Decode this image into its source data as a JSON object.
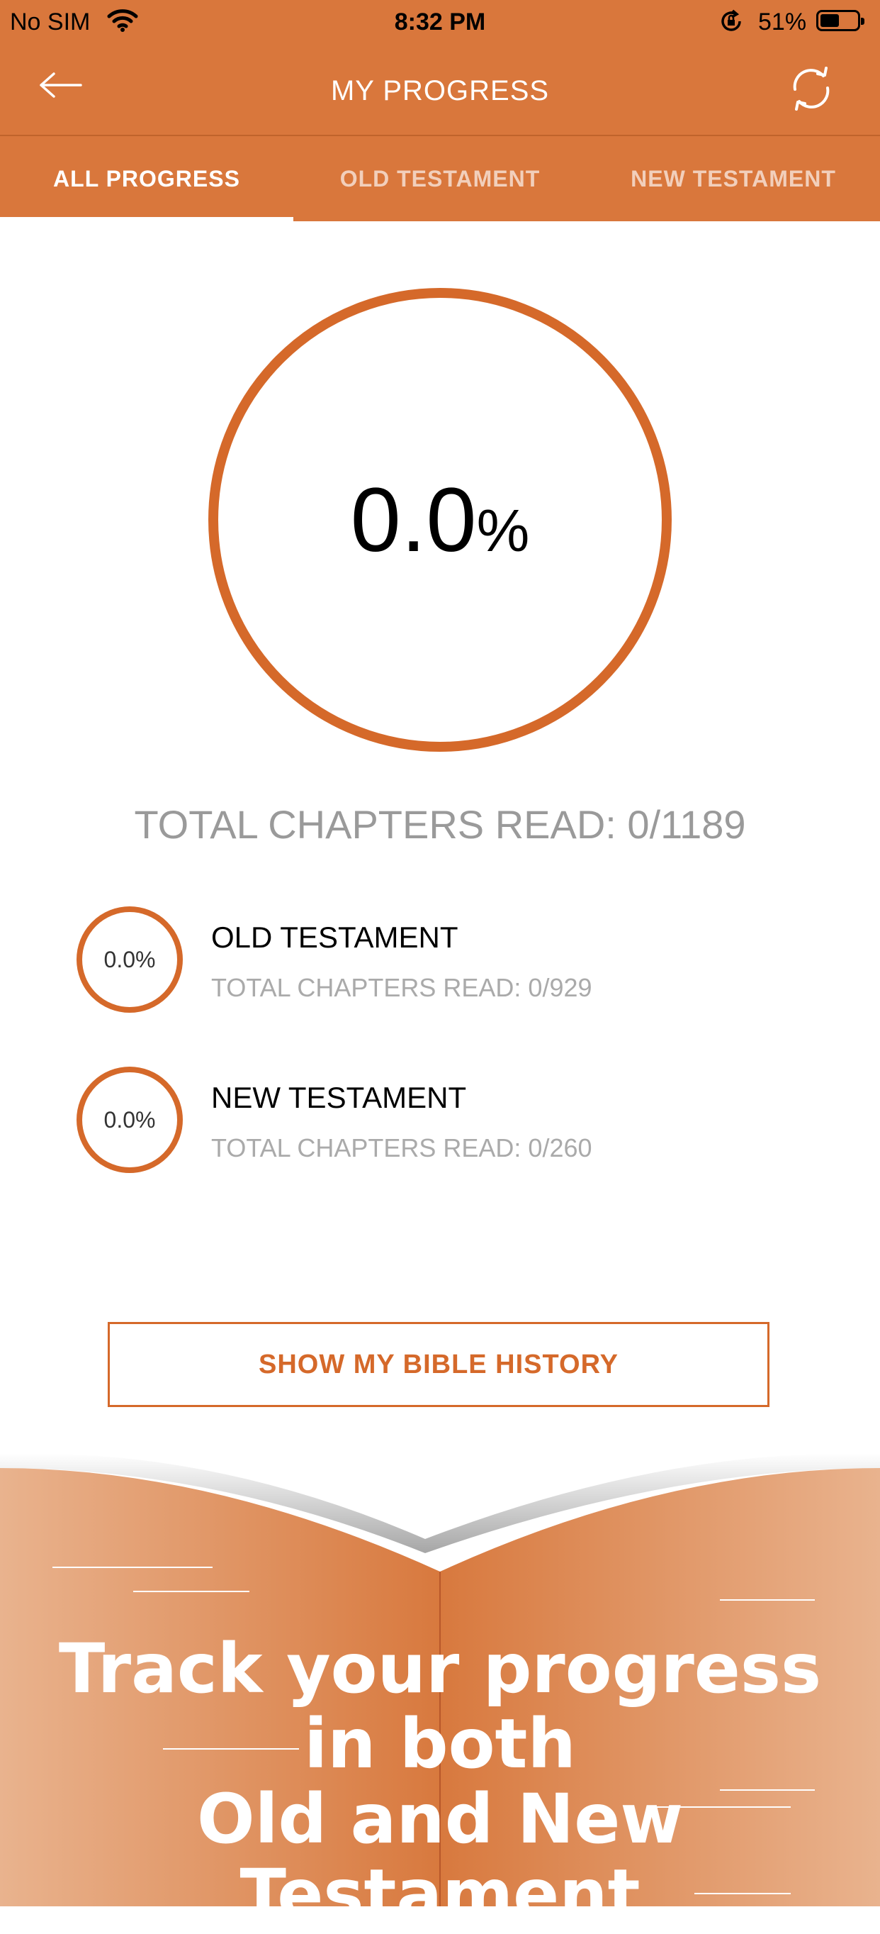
{
  "status_bar": {
    "carrier": "No SIM",
    "time": "8:32 PM",
    "battery": "51%",
    "battery_level": 0.51
  },
  "nav": {
    "title": "MY PROGRESS",
    "back_icon": "arrow-left-icon",
    "sync_icon": "sync-icon"
  },
  "tabs": [
    {
      "label": "ALL PROGRESS",
      "active": true
    },
    {
      "label": "OLD TESTAMENT",
      "active": false
    },
    {
      "label": "NEW TESTAMENT",
      "active": false
    }
  ],
  "overall": {
    "percent": "0.0",
    "percent_sign": "%",
    "total_label": "TOTAL CHAPTERS READ: 0/1189"
  },
  "testaments": [
    {
      "percent": "0.0%",
      "name": "OLD TESTAMENT",
      "chapters": "TOTAL CHAPTERS READ: 0/929"
    },
    {
      "percent": "0.0%",
      "name": "NEW TESTAMENT",
      "chapters": "TOTAL CHAPTERS READ: 0/260"
    }
  ],
  "history_button": "SHOW MY BIBLE HISTORY",
  "promo": {
    "line1": "Track your progress",
    "line2": "in both",
    "line3": "Old and New Testament"
  },
  "colors": {
    "accent": "#d5692a",
    "bar": "#d9773c"
  }
}
